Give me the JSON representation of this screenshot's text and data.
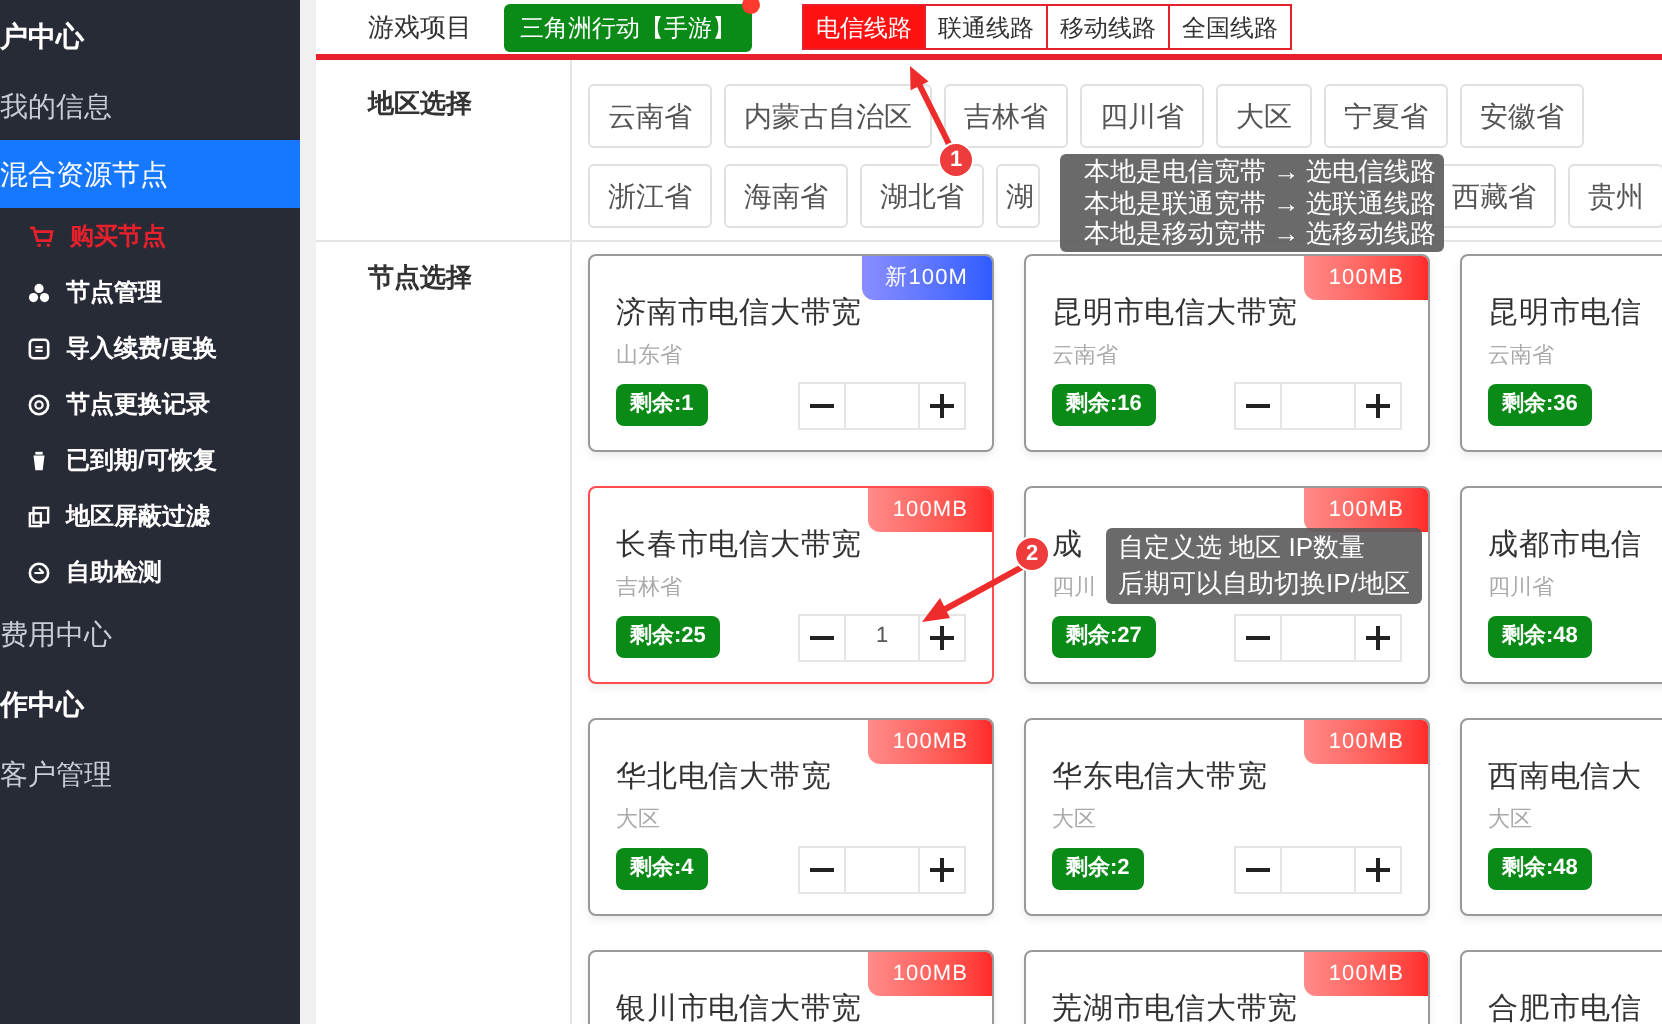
{
  "sidebar": {
    "items": [
      {
        "label": "户中心",
        "kind": "header"
      },
      {
        "label": "我的信息",
        "kind": "group",
        "selected": false
      },
      {
        "label": "混合资源节点",
        "kind": "group",
        "selected": true
      },
      {
        "label": "购买节点",
        "kind": "sub",
        "selected": true
      },
      {
        "label": "节点管理",
        "kind": "sub",
        "selected": false
      },
      {
        "label": "导入续费/更换",
        "kind": "sub",
        "selected": false
      },
      {
        "label": "节点更换记录",
        "kind": "sub",
        "selected": false
      },
      {
        "label": "已到期/可恢复",
        "kind": "sub",
        "selected": false
      },
      {
        "label": "地区屏蔽过滤",
        "kind": "sub",
        "selected": false
      },
      {
        "label": "自助检测",
        "kind": "sub",
        "selected": false
      },
      {
        "label": "费用中心",
        "kind": "group",
        "selected": false
      },
      {
        "label": "作中心",
        "kind": "header"
      },
      {
        "label": "客户管理",
        "kind": "group",
        "selected": false
      }
    ]
  },
  "game": {
    "label": "游戏项目",
    "button": "三角洲行动【手游】"
  },
  "lines": [
    {
      "label": "电信线路",
      "selected": true
    },
    {
      "label": "联通线路",
      "selected": false
    },
    {
      "label": "移动线路",
      "selected": false
    },
    {
      "label": "全国线路",
      "selected": false
    }
  ],
  "regions": {
    "label": "地区选择",
    "chips": [
      "云南省",
      "内蒙古自治区",
      "吉林省",
      "四川省",
      "大区",
      "宁夏省",
      "安徽省",
      "浙江省",
      "海南省",
      "湖北省",
      "湖",
      "西藏省",
      "贵州"
    ]
  },
  "nodes": {
    "label": "节点选择",
    "cards": [
      {
        "title": "济南市电信大带宽",
        "province": "山东省",
        "remain": "剩余:1",
        "badge": {
          "text": "新100M",
          "kind": "new"
        },
        "selected": false
      },
      {
        "title": "昆明市电信大带宽",
        "province": "云南省",
        "remain": "剩余:16",
        "badge": {
          "text": "100MB",
          "kind": "normal"
        },
        "selected": false
      },
      {
        "title": "昆明市电信",
        "province": "云南省",
        "remain": "剩余:36",
        "selected": false
      },
      {
        "title": "长春市电信大带宽",
        "province": "吉林省",
        "remain": "剩余:25",
        "badge": {
          "text": "100MB",
          "kind": "normal"
        },
        "value": "1",
        "selected": true
      },
      {
        "title": "成",
        "province": "四川",
        "remain": "剩余:27",
        "badge": {
          "text": "100MB",
          "kind": "normal"
        },
        "selected": false
      },
      {
        "title": "成都市电信",
        "province": "四川省",
        "remain": "剩余:48",
        "selected": false
      },
      {
        "title": "华北电信大带宽",
        "province": "大区",
        "remain": "剩余:4",
        "badge": {
          "text": "100MB",
          "kind": "normal"
        },
        "selected": false
      },
      {
        "title": "华东电信大带宽",
        "province": "大区",
        "remain": "剩余:2",
        "badge": {
          "text": "100MB",
          "kind": "normal"
        },
        "selected": false
      },
      {
        "title": "西南电信大",
        "province": "大区",
        "remain": "剩余:48",
        "selected": false
      },
      {
        "title": "银川市电信大带宽",
        "badge": {
          "text": "100MB",
          "kind": "normal"
        },
        "selected": false
      },
      {
        "title": "芜湖市电信大带宽",
        "badge": {
          "text": "100MB",
          "kind": "normal"
        },
        "selected": false
      },
      {
        "title": "合肥市电信",
        "selected": false
      }
    ]
  },
  "tips": [
    {
      "number": "1",
      "lines": [
        "本地是电信宽带 → 选电信线路",
        "本地是联通宽带 → 选联通线路",
        "本地是移动宽带 → 选移动线路"
      ]
    },
    {
      "number": "2",
      "lines": [
        "自定义选 地区 IP数量",
        "后期可以自助切换IP/地区"
      ]
    }
  ]
}
